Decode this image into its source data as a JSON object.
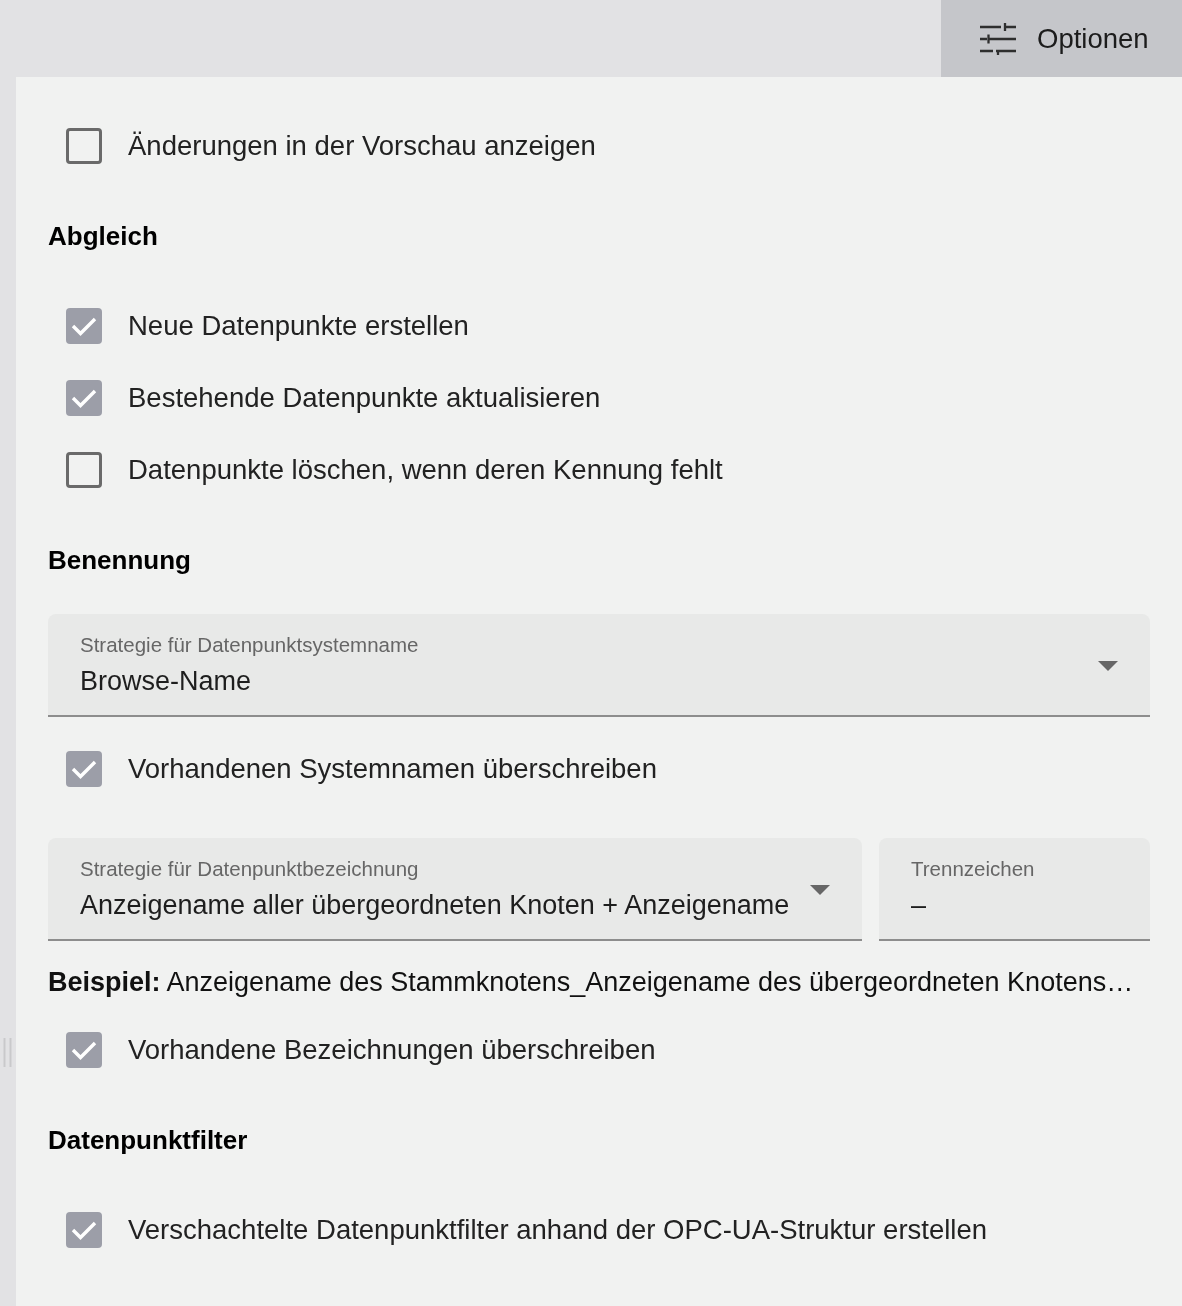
{
  "toolbar": {
    "options_button": {
      "label": "Optionen"
    }
  },
  "panel": {
    "items": [
      {
        "kind": "checkbox",
        "label": "Änderungen in der Vorschau anzeigen",
        "checked": false
      },
      {
        "kind": "heading",
        "text": "**Abgleich**"
      },
      {
        "kind": "checkbox",
        "label": "Neue Datenpunkte erstellen",
        "checked": true
      },
      {
        "kind": "checkbox",
        "label": "Bestehende Datenpunkte aktualisieren",
        "checked": true
      },
      {
        "kind": "checkbox",
        "label": "Datenpunkte löschen, wenn deren Kennung fehlt",
        "checked": false
      },
      {
        "kind": "heading",
        "text": "**Benennung**"
      },
      {
        "kind": "select",
        "label": "Strategie für Datenpunktsystemname",
        "value": "Browse-Name"
      },
      {
        "kind": "checkbox",
        "label": "Vorhandenen Systemnamen überschreiben",
        "checked": true
      },
      {
        "kind": "select_with_field",
        "select": {
          "label": "Strategie für Datenpunktbezeichnung",
          "value": "Anzeigename aller übergeordneten Knoten + Anzeigename"
        },
        "field": {
          "label": "Trennzeichen",
          "value": "–"
        }
      },
      {
        "kind": "example",
        "text": "**Beispiel:** Anzeigename des Stammknotens_Anzeigename des übergeordneten Knotens…"
      },
      {
        "kind": "checkbox",
        "label": "Vorhandene Bezeichnungen überschreiben",
        "checked": true
      },
      {
        "kind": "heading",
        "text": "**Datenpunktfilter**"
      },
      {
        "kind": "checkbox",
        "label": "Verschachtelte Datenpunktfilter anhand der OPC-UA-Struktur erstellen",
        "checked": true
      }
    ]
  }
}
